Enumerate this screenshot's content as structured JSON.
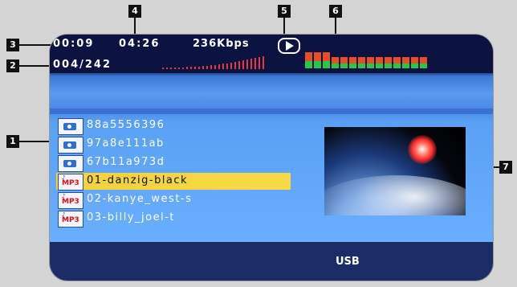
{
  "status": {
    "elapsed": "00:09",
    "total": "04:26",
    "bitrate": "236Kbps",
    "track_counter": "004/242",
    "play_state": "play-icon"
  },
  "callouts": [
    "1",
    "2",
    "3",
    "4",
    "5",
    "6",
    "7"
  ],
  "file_list": [
    {
      "type": "photo",
      "label": "88a5556396"
    },
    {
      "type": "photo",
      "label": "97a8e111ab"
    },
    {
      "type": "photo",
      "label": "67b11a973d"
    },
    {
      "type": "mp3",
      "label": "01-danzig-black",
      "selected": true
    },
    {
      "type": "mp3",
      "label": "02-kanye_west-s"
    },
    {
      "type": "mp3",
      "label": "03-billy_joel-t"
    }
  ],
  "icons": {
    "photo": "photo-file-icon",
    "mp3": "mp3-file-icon",
    "mp3_text": "MP3"
  },
  "footer": {
    "source": "USB"
  },
  "colors": {
    "selection": "#f3d23a",
    "background": "#6cb0ff",
    "topbar": "#0c1340"
  }
}
